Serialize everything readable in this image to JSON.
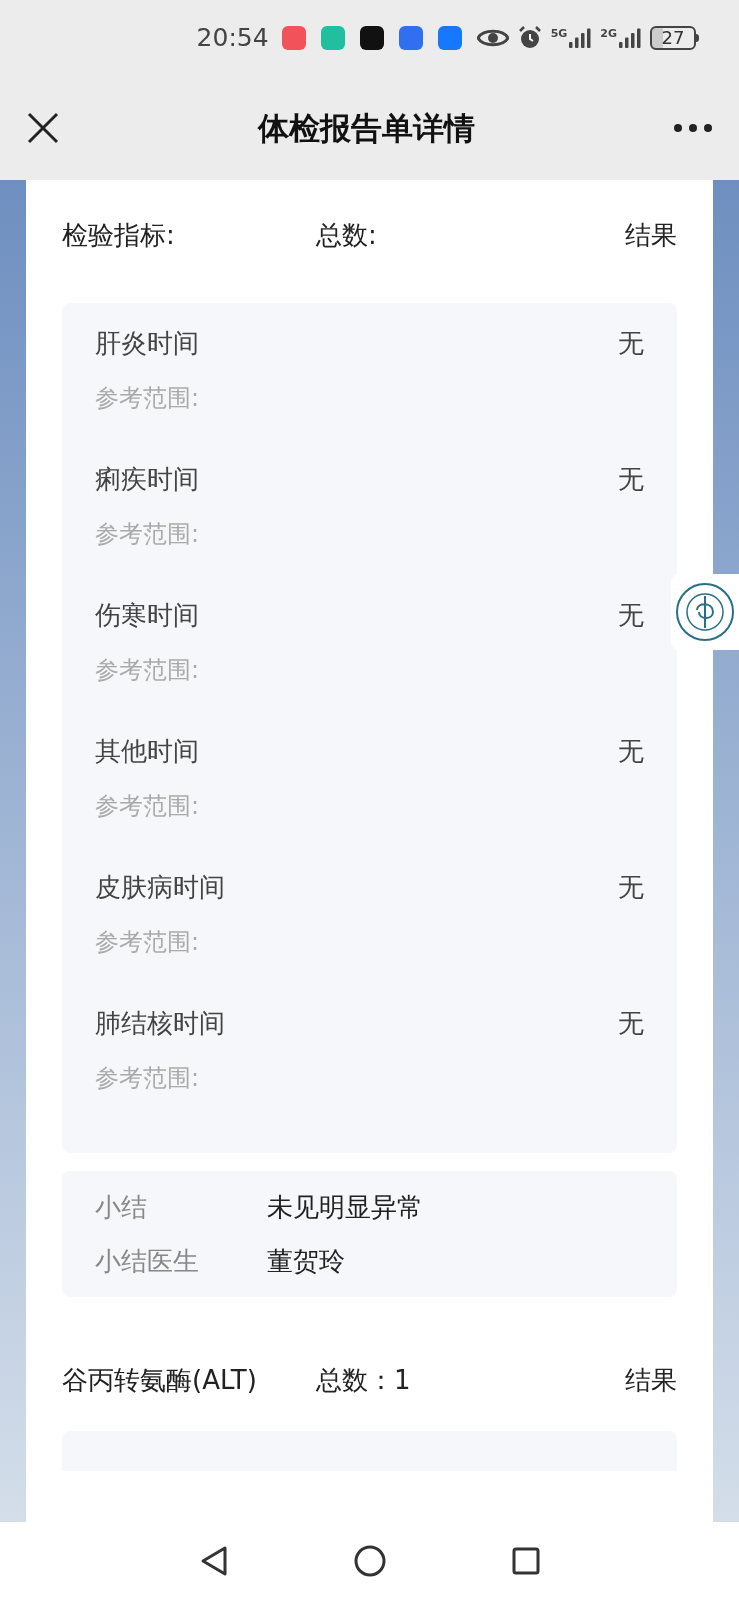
{
  "status_bar": {
    "time": "20:54",
    "app_icons": [
      {
        "color": "#f2525a"
      },
      {
        "color": "#1fbfa0"
      },
      {
        "color": "#111111"
      },
      {
        "color": "#2f6ff0"
      },
      {
        "color": "#1677ff"
      }
    ],
    "network_1": "5G",
    "network_2": "2G",
    "battery": "27"
  },
  "header": {
    "title": "体检报告单详情"
  },
  "sections": [
    {
      "name": "检验指标:",
      "total": "总数:",
      "result_label": "结果",
      "items": [
        {
          "name": "肝炎时间",
          "value": "无",
          "reference": "参考范围:"
        },
        {
          "name": "痢疾时间",
          "value": "无",
          "reference": "参考范围:"
        },
        {
          "name": "伤寒时间",
          "value": "无",
          "reference": "参考范围:"
        },
        {
          "name": "其他时间",
          "value": "无",
          "reference": "参考范围:"
        },
        {
          "name": "皮肤病时间",
          "value": "无",
          "reference": "参考范围:"
        },
        {
          "name": "肺结核时间",
          "value": "无",
          "reference": "参考范围:"
        }
      ],
      "summary": [
        {
          "label": "小结",
          "value": "未见明显异常"
        },
        {
          "label": "小结医生",
          "value": "董贺玲"
        }
      ]
    },
    {
      "name": "谷丙转氨酶(ALT)",
      "total": "总数：1",
      "result_label": "结果"
    }
  ]
}
